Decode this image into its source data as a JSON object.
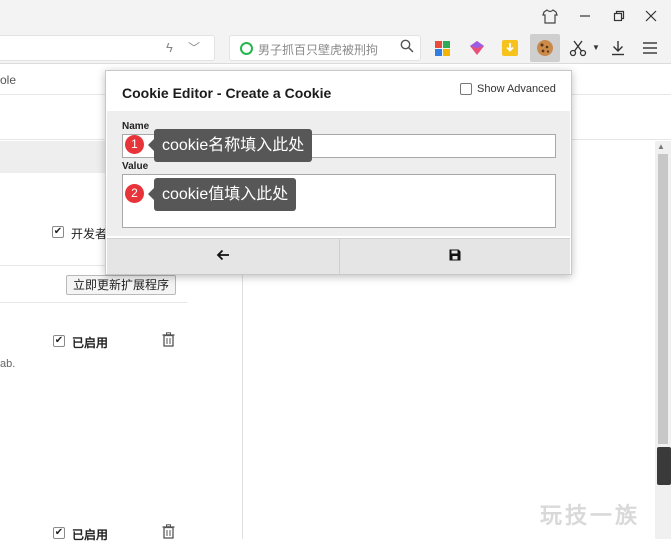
{
  "toolbar": {
    "search_placeholder": "男子抓百只壁虎被刑拘",
    "bookmark_fragment": "ole",
    "colors": {
      "search_ring": "#25b64e",
      "download_ext": "#f6c21c",
      "active_ext_bg": "#cfcfcf"
    }
  },
  "popup": {
    "title": "Cookie Editor - Create a Cookie",
    "show_advanced_label": "Show Advanced",
    "show_advanced_checked": false,
    "name_label": "Name",
    "value_label": "Value",
    "name_value": "",
    "value_value": ""
  },
  "callouts": [
    {
      "number": "1",
      "text": "cookie名称填入此处"
    },
    {
      "number": "2",
      "text": "cookie值填入此处"
    }
  ],
  "page": {
    "developer_mode_label": "开发者",
    "update_button_label": "立即更新扩展程序",
    "enabled_label_1": "已启用",
    "enabled_label_2": "已启用",
    "snippet": "ab."
  },
  "watermark": "玩技一族"
}
